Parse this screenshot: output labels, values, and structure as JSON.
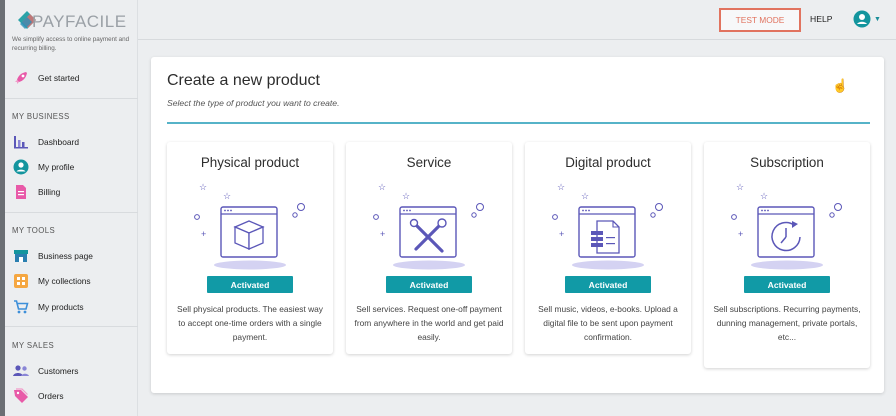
{
  "brand": {
    "name": "PAYFACILE",
    "tagline": "We simplify access to online payment and recurring billing."
  },
  "sidebar": {
    "get_started": "Get started",
    "sections": [
      {
        "heading": "MY BUSINESS",
        "items": [
          "Dashboard",
          "My profile",
          "Billing"
        ]
      },
      {
        "heading": "MY TOOLS",
        "items": [
          "Business page",
          "My collections",
          "My products"
        ]
      },
      {
        "heading": "MY SALES",
        "items": [
          "Customers",
          "Orders"
        ]
      }
    ]
  },
  "topbar": {
    "test_mode": "TEST MODE",
    "help": "HELP"
  },
  "main": {
    "title": "Create a new product",
    "subtitle": "Select the type of product you want to create.",
    "cards": [
      {
        "title": "Physical product",
        "badge": "Activated",
        "description": "Sell physical products. The easiest way to accept one-time orders with a single payment."
      },
      {
        "title": "Service",
        "badge": "Activated",
        "description": "Sell services. Request one-off payment from anywhere in the world and get paid easily."
      },
      {
        "title": "Digital product",
        "badge": "Activated",
        "description": "Sell music, videos, e-books. Upload a digital file to be sent upon payment confirmation."
      },
      {
        "title": "Subscription",
        "badge": "Activated",
        "description": "Sell subscriptions. Recurring payments, dunning management, private portals, etc..."
      }
    ]
  },
  "colors": {
    "accent": "#119aa6",
    "test_mode": "#e1735f",
    "illustration": "#5b57b8",
    "divider": "#56b3c8"
  },
  "icons": {
    "get_started": "rocket-icon",
    "dashboard": "bar-chart-icon",
    "my_profile": "user-circle-icon",
    "billing": "document-icon",
    "business_page": "storefront-icon",
    "my_collections": "collection-icon",
    "my_products": "cart-icon",
    "customers": "people-icon",
    "orders": "tags-icon",
    "account": "account-circle-icon"
  }
}
